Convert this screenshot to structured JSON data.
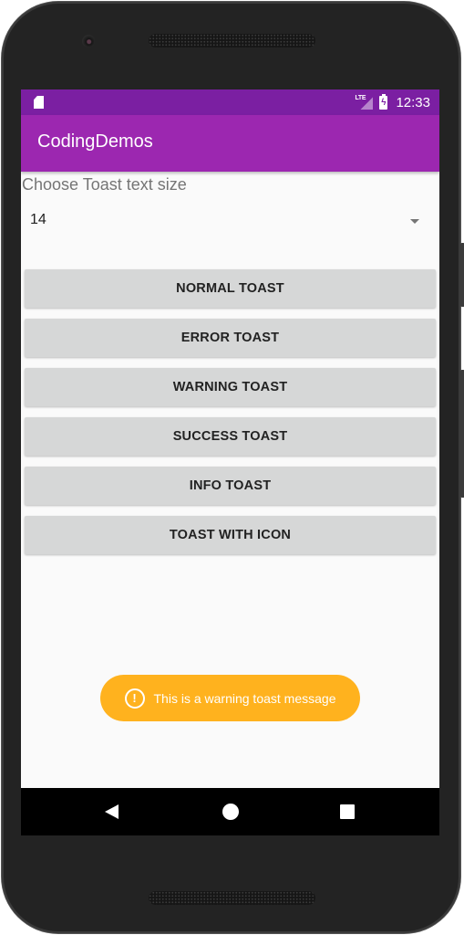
{
  "status_bar": {
    "left_icon": "sd-card-icon",
    "network_label": "LTE",
    "signal_icon": "signal-icon",
    "battery_icon": "battery-charging-icon",
    "battery_bolt": "ϟ",
    "time": "12:33"
  },
  "app_bar": {
    "title": "CodingDemos"
  },
  "form": {
    "text_size_label": "Choose Toast text size",
    "text_size_spinner": {
      "selected_value": "14",
      "dropdown_icon": "dropdown-arrow-icon"
    }
  },
  "buttons": [
    {
      "label": "NORMAL TOAST"
    },
    {
      "label": "ERROR TOAST"
    },
    {
      "label": "WARNING TOAST"
    },
    {
      "label": "SUCCESS TOAST"
    },
    {
      "label": "INFO TOAST"
    },
    {
      "label": "TOAST WITH ICON"
    }
  ],
  "toast": {
    "type": "warning",
    "icon": "warning-circle-icon",
    "icon_glyph": "!",
    "message": "This is a warning toast message",
    "color": "#ffb21e"
  },
  "nav_bar": {
    "back": "back-icon",
    "home": "home-icon",
    "recents": "recents-icon"
  },
  "colors": {
    "status_bar": "#7b1fa2",
    "app_bar": "#9c27b0",
    "button_bg": "#d6d7d7",
    "background": "#fafafa"
  }
}
